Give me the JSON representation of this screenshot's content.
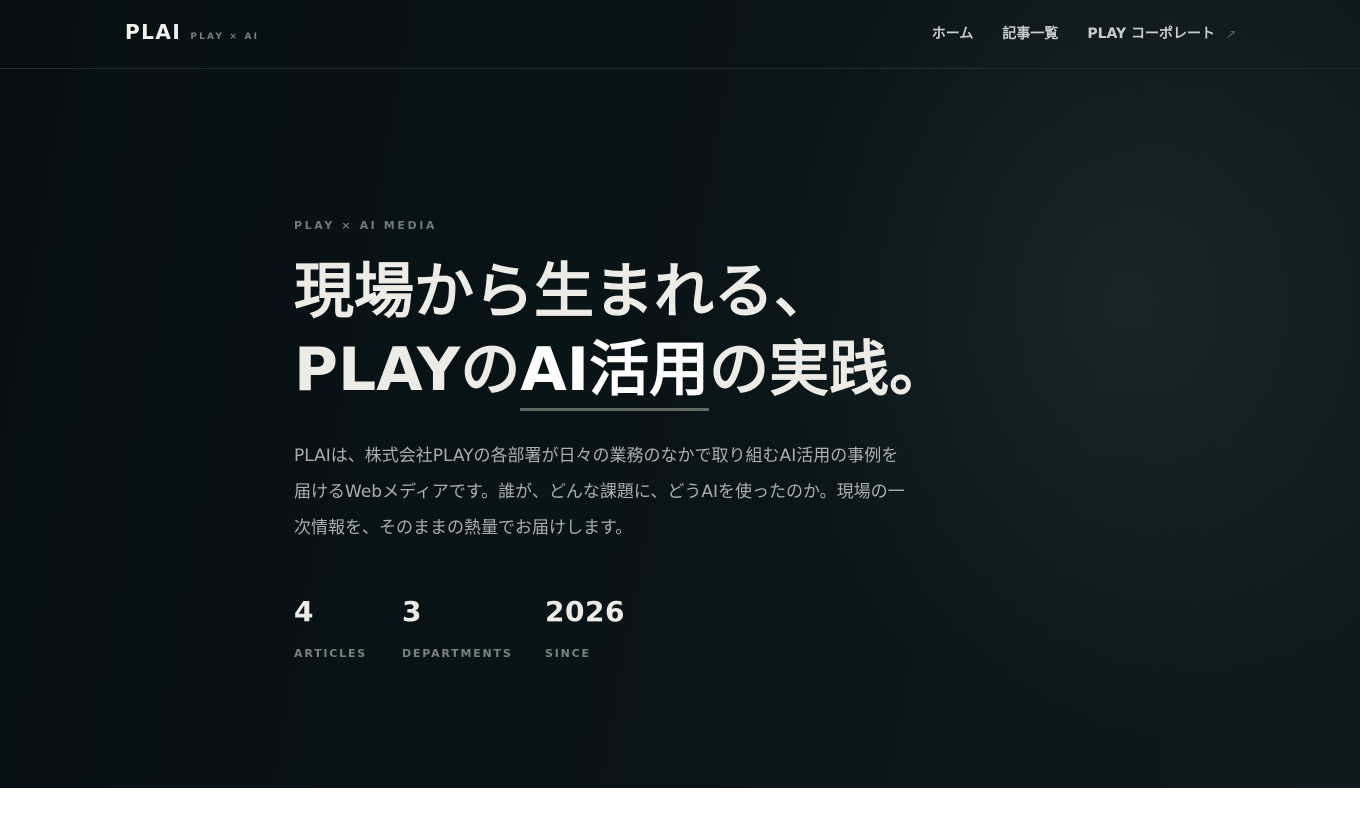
{
  "header": {
    "logo": "PLAI",
    "tagline": "PLAY × AI",
    "nav": [
      {
        "label": "ホーム"
      },
      {
        "label": "記事一覧"
      },
      {
        "label": "PLAY コーポレート",
        "external_icon": "↗"
      }
    ]
  },
  "hero": {
    "eyebrow": "PLAY × AI MEDIA",
    "headline_line1": "現場から生まれる、",
    "headline_line2_pre": "PLAYの",
    "headline_line2_accent": "AI活用",
    "headline_line2_post": "の実践。",
    "lead": "PLAIは、株式会社PLAYの各部署が日々の業務のなかで取り組むAI活用の事例を届けるWebメディアです。誰が、どんな課題に、どうAIを使ったのか。現場の一次情報を、そのままの熱量でお届けします。",
    "stats": [
      {
        "value": "4",
        "label": "ARTICLES"
      },
      {
        "value": "3",
        "label": "DEPARTMENTS"
      },
      {
        "value": "2026",
        "label": "SINCE"
      }
    ]
  },
  "colors": {
    "background": "#0a1519",
    "text_primary": "#ecebe6",
    "text_muted": "#a9afad",
    "accent_underline": "#5f6968"
  }
}
